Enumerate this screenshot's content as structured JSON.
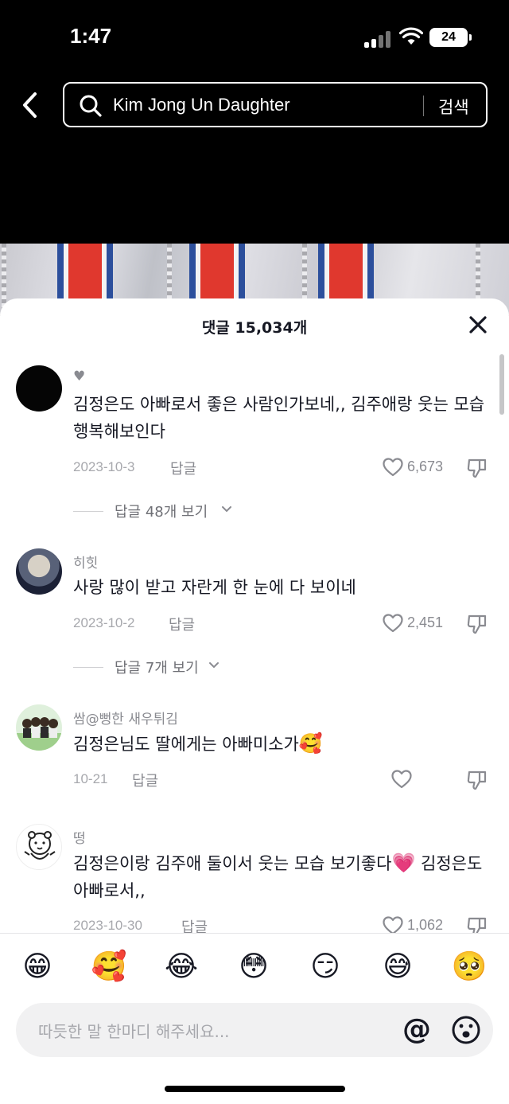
{
  "status_bar": {
    "time": "1:47",
    "battery": "24"
  },
  "search": {
    "query": "Kim Jong Un Daughter",
    "button_label": "검색"
  },
  "sheet": {
    "title": "댓글 15,034개"
  },
  "comments": [
    {
      "username": "♥",
      "text": "김정은도 아빠로서 좋은 사람인가보네,, 김주애랑 웃는 모습 행복해보인다",
      "date": "2023-10-3",
      "reply_label": "답글",
      "likes": "6,673",
      "view_replies": "답글 48개 보기"
    },
    {
      "username": "히힛",
      "text": "사랑 많이 받고 자란게 한 눈에 다 보이네",
      "date": "2023-10-2",
      "reply_label": "답글",
      "likes": "2,451",
      "view_replies": "답글 7개 보기"
    },
    {
      "username": "쌈@뻥한 새우튀김",
      "text": "김정은님도 딸에게는 아빠미소가",
      "text_emoji": "🥰",
      "date": "10-21",
      "reply_label": "답글",
      "likes": ""
    },
    {
      "username": "떵",
      "text": "김정은이랑 김주애 둘이서 웃는 모습 보기좋다",
      "text_emoji": "💗",
      "text_tail": " 김정은도 아빠로서,,",
      "date": "2023-10-30",
      "reply_label": "답글",
      "likes": "1,062"
    }
  ],
  "emoji_bar": [
    "😁",
    "🥰",
    "😂",
    "😳",
    "😏",
    "😅",
    "🥺"
  ],
  "input": {
    "placeholder": "따듯한 말 한마디 해주세요...",
    "mention": "@"
  },
  "colors": {
    "sheet_bg": "#ffffff",
    "text_primary": "#161823",
    "text_secondary": "#8a8b91"
  }
}
